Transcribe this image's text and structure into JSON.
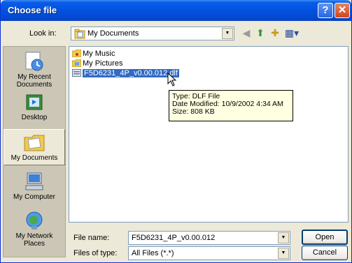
{
  "window": {
    "title": "Choose file",
    "help_glyph": "?",
    "close_glyph": "✕"
  },
  "look_in": {
    "label": "Look in:",
    "value": "My Documents"
  },
  "toolbar": {
    "back_glyph": "◀",
    "up_glyph": "⬆",
    "new_folder_glyph": "✚",
    "views_glyph": "▦▾"
  },
  "places": [
    {
      "label_line1": "My Recent",
      "label_line2": "Documents",
      "icon": "recent-documents-icon"
    },
    {
      "label_line1": "Desktop",
      "label_line2": "",
      "icon": "desktop-icon"
    },
    {
      "label_line1": "My Documents",
      "label_line2": "",
      "icon": "my-documents-icon"
    },
    {
      "label_line1": "My Computer",
      "label_line2": "",
      "icon": "my-computer-icon"
    },
    {
      "label_line1": "My Network",
      "label_line2": "Places",
      "icon": "network-places-icon"
    }
  ],
  "files": [
    {
      "name": "My Music",
      "icon": "music-folder-icon"
    },
    {
      "name": "My Pictures",
      "icon": "pictures-folder-icon"
    },
    {
      "name": "F5D6231_4P_v0.00.012.dlf",
      "icon": "file-icon"
    }
  ],
  "tooltip": {
    "type": "Type: DLF File",
    "modified": "Date Modified: 10/9/2002 4:34 AM",
    "size": "Size: 808 KB"
  },
  "file_name": {
    "label": "File name:",
    "value": "F5D6231_4P_v0.00.012"
  },
  "file_type": {
    "label": "Files of type:",
    "value": "All Files (*.*)"
  },
  "buttons": {
    "open": "Open",
    "cancel": "Cancel"
  },
  "colors": {
    "titlebar": "#0351e0",
    "selection": "#316ac5",
    "tooltip_bg": "#ffffe1"
  }
}
